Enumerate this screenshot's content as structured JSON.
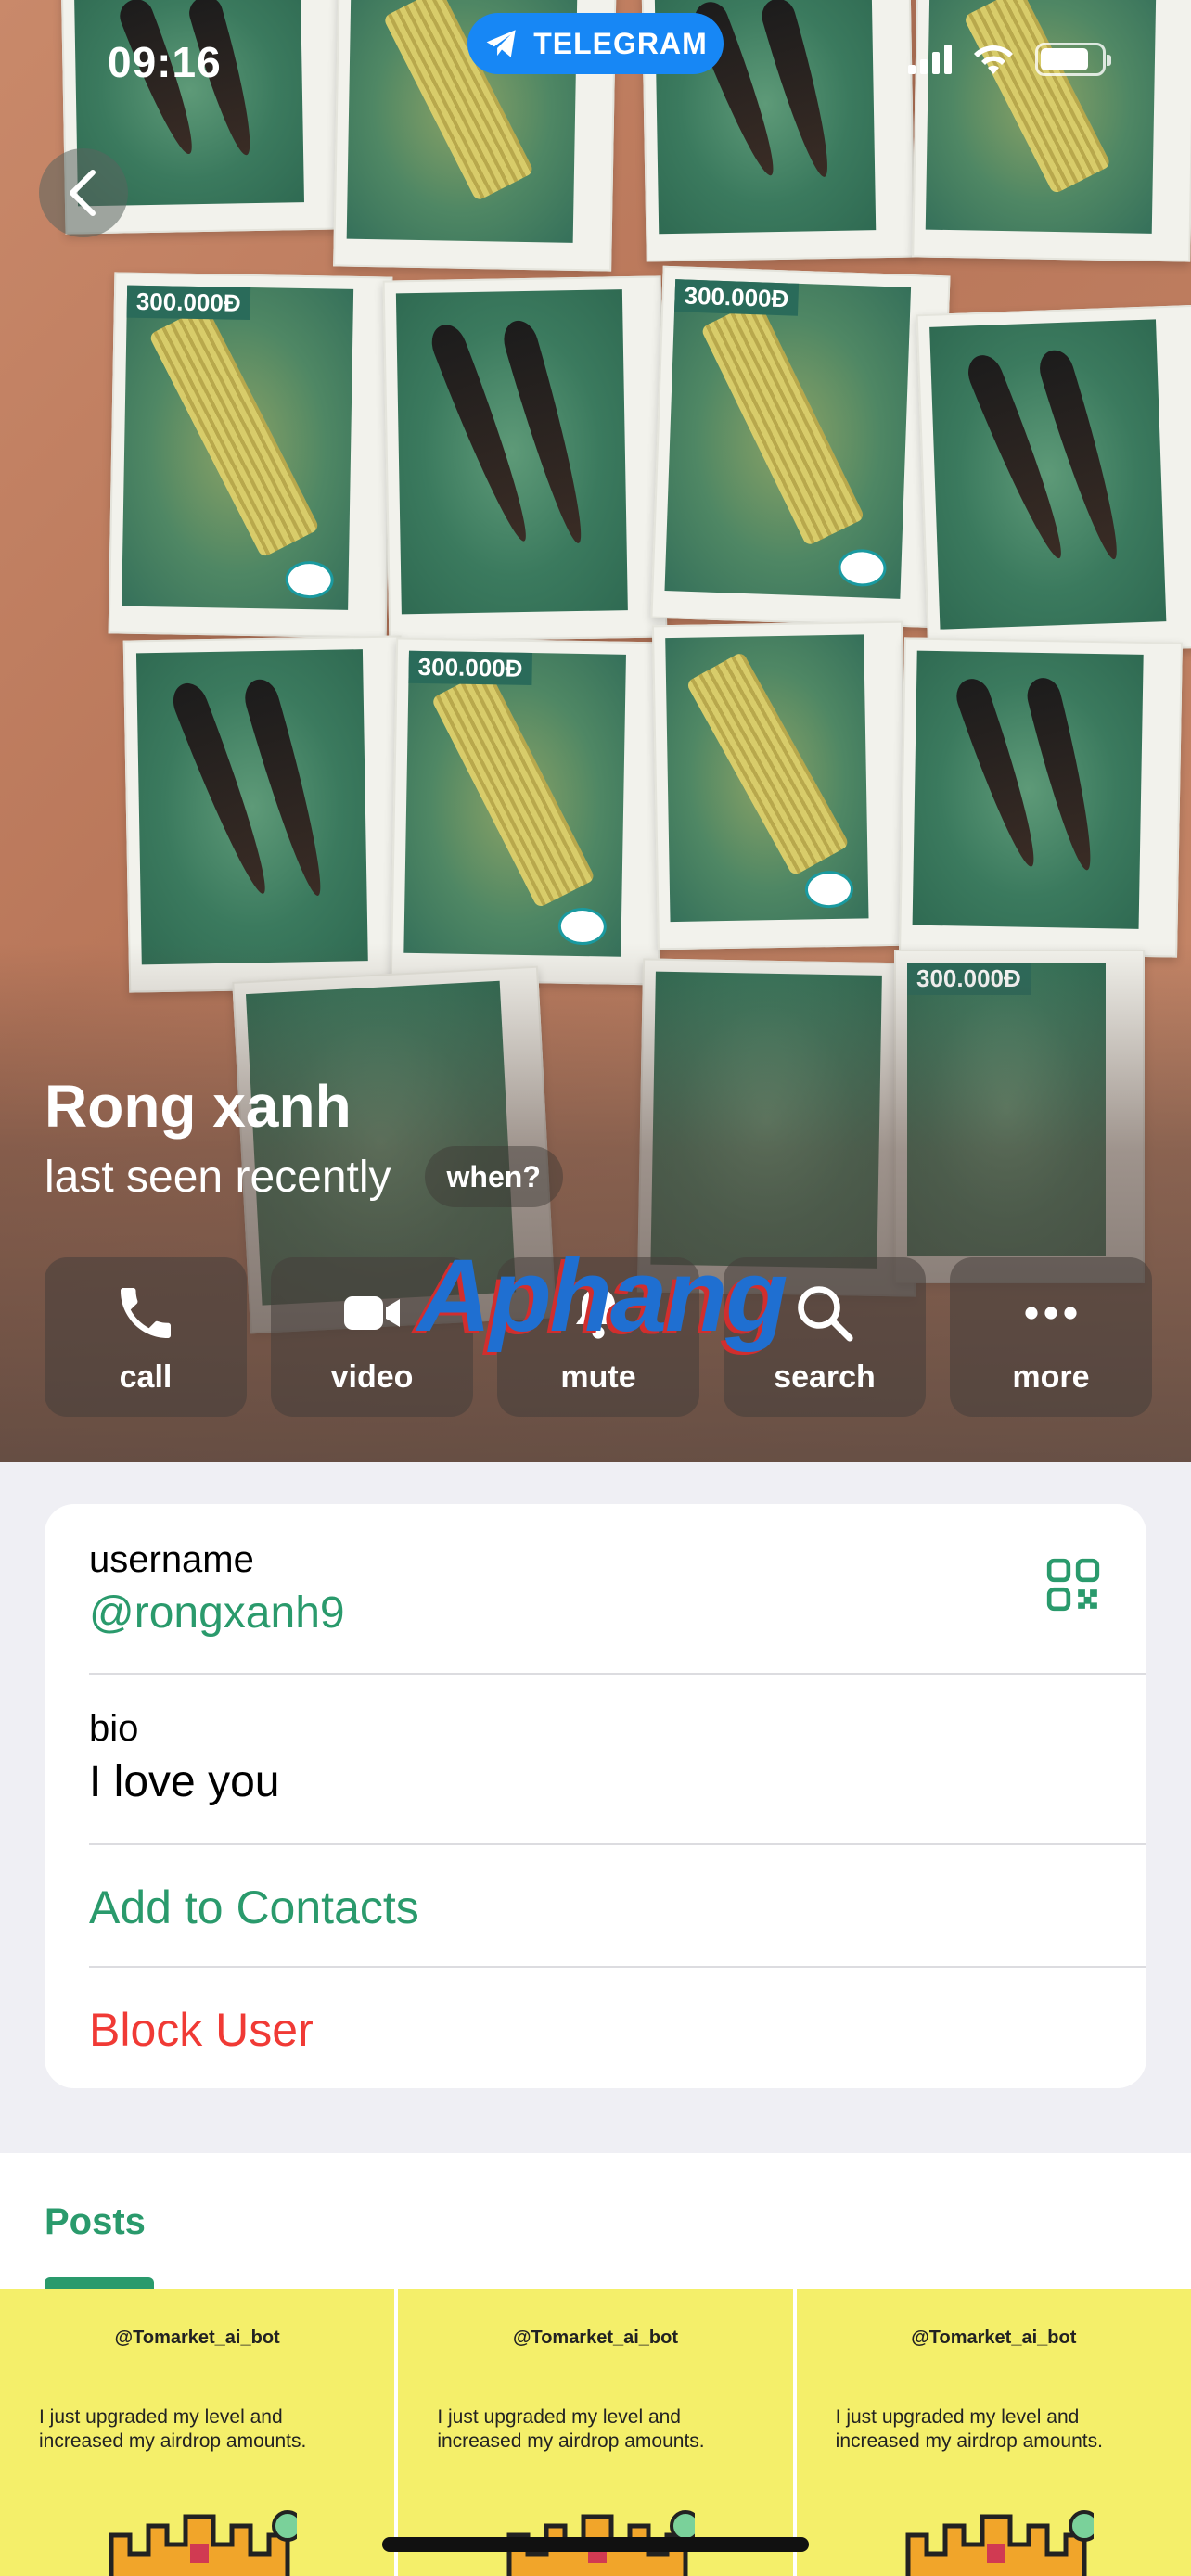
{
  "status_bar": {
    "time": "09:16",
    "app_pill": "TELEGRAM",
    "icons": [
      "cellular-signal-icon",
      "wifi-icon",
      "battery-icon"
    ]
  },
  "header": {
    "back_icon": "chevron-left-icon",
    "photo_price_label": "300.000Đ"
  },
  "profile": {
    "name": "Rong xanh",
    "last_seen": "last seen recently",
    "when_label": "when?"
  },
  "actions": [
    {
      "label": "call",
      "icon": "phone-icon"
    },
    {
      "label": "video",
      "icon": "video-camera-icon"
    },
    {
      "label": "mute",
      "icon": "bell-icon"
    },
    {
      "label": "search",
      "icon": "search-icon"
    },
    {
      "label": "more",
      "icon": "more-dots-icon"
    }
  ],
  "watermark": "Aphang",
  "info": {
    "username_label": "username",
    "username_value": "@rongxanh9",
    "bio_label": "bio",
    "bio_value": "I love you",
    "add_contact": "Add to Contacts",
    "block_user": "Block User"
  },
  "posts": {
    "tab_label": "Posts",
    "items": [
      {
        "handle": "@Tomarket_ai_bot",
        "text": "I just upgraded my level and increased my airdrop amounts."
      },
      {
        "handle": "@Tomarket_ai_bot",
        "text": "I just upgraded my level and increased my airdrop amounts."
      },
      {
        "handle": "@Tomarket_ai_bot",
        "text": "I just upgraded my level and increased my airdrop amounts."
      }
    ]
  },
  "colors": {
    "accent_green": "#2a9a6c",
    "danger_red": "#f03a35",
    "telegram_blue": "#1787f5",
    "post_yellow": "#f4ef6a"
  }
}
